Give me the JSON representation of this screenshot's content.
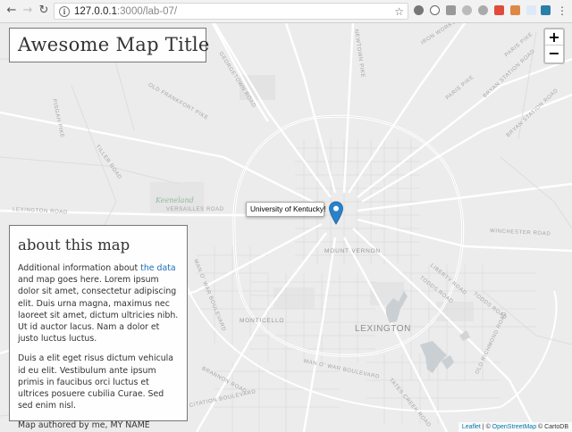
{
  "browser": {
    "url_host": "127.0.0.1",
    "url_rest": ":3000/lab-07/"
  },
  "map": {
    "title": "Awesome Map Title",
    "zoom_in": "+",
    "zoom_out": "−",
    "popup": "University of Kentucky!",
    "places": {
      "city": "LEXINGTON",
      "nbh_mount_vernon": "MOUNT VERNON",
      "nbh_monticello": "MONTICELLO",
      "keeneland": "Keeneland"
    },
    "roads": {
      "newtown_pike": "NEWTOWN PIKE",
      "iron_works": "IRON WORKS ROAD",
      "paris_pike": "PARIS PIKE",
      "paris_pike_2": "PARIS PIKE",
      "georgetown": "GEORGETOWN ROAD",
      "old_frankfort": "OLD FRANKFORT PIKE",
      "pisgah": "PISGAH PIKE",
      "bryan_station": "BRYAN STATION ROAD",
      "bryan_station_2": "BRYAN STATION ROAD",
      "tiller": "TILLER ROAD",
      "lexington_rd": "LEXINGTON ROAD",
      "versailles": "VERSAILLES ROAD",
      "winchester": "WINCHESTER ROAD",
      "liberty": "LIBERTY ROAD",
      "todds": "TODDS ROAD",
      "todds_2": "TODDS ROAD",
      "man_o_war": "MAN O' WAR BOULEVARD",
      "man_o_war_2": "MAN O' WAR BOULEVARD",
      "brannon": "BRANNON ROAD",
      "old_richmond": "OLD RICHMOND ROAD",
      "tates_creek": "TATES CREEK ROAD",
      "citation": "CITATION BOULEVARD"
    },
    "attribution": {
      "leaflet": "Leaflet",
      "sep1": " | © ",
      "osm": "OpenStreetMap",
      "sep2": " © ",
      "carto": "CartoDB"
    }
  },
  "info": {
    "heading": "about this map",
    "p1_before": "Additional information about ",
    "p1_link": "the data",
    "p1_after": " and map goes here. Lorem ipsum dolor sit amet, consectetur adipiscing elit. Duis urna magna, maximus nec laoreet sit amet, dictum ultricies nibh. Ut id auctor lacus. Nam a dolor et justo luctus luctus.",
    "p2": "Duis a elit eget risus dictum vehicula id eu elit. Vestibulum ante ipsum primis in faucibus orci luctus et ultrices posuere cubilia Curae. Sed sed enim nisl.",
    "p3": "Map authored by me, MY NAME"
  },
  "colors": {
    "map_bg": "#ececec",
    "road_major": "#ffffff",
    "road_minor": "#dedede",
    "water": "#c7cdd1",
    "park": "#e2e2e2",
    "link": "#1f6fb5",
    "marker": "#2a81cb"
  }
}
